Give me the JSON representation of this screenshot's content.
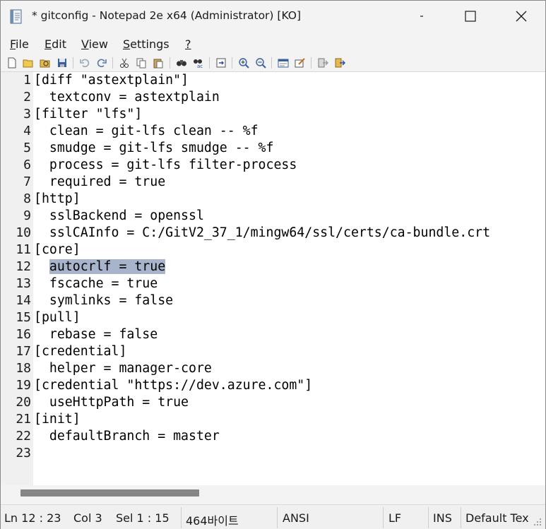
{
  "window": {
    "title": "* gitconfig - Notepad 2e x64 (Administrator) [KO]",
    "min_icon": "minimize-icon",
    "max_icon": "maximize-icon",
    "close_icon": "close-icon"
  },
  "menu": [
    {
      "label": "File",
      "u": "F",
      "rest": "ile"
    },
    {
      "label": "Edit",
      "u": "E",
      "rest": "dit"
    },
    {
      "label": "View",
      "u": "V",
      "rest": "iew"
    },
    {
      "label": "Settings",
      "u": "S",
      "rest": "ettings"
    },
    {
      "label": "?",
      "u": "?",
      "rest": ""
    }
  ],
  "toolbar": [
    "new-file-icon",
    "open-file-icon",
    "browse-icon",
    "save-icon",
    "undo-icon",
    "redo-icon",
    "cut-icon",
    "copy-icon",
    "paste-icon",
    "find-icon",
    "replace-icon",
    "goto-icon",
    "zoom-in-icon",
    "zoom-out-icon",
    "word-wrap-icon",
    "scheme-icon",
    "exit-icon",
    "save-and-exit-icon"
  ],
  "editor": {
    "lines": [
      {
        "n": "1",
        "text": "[diff \"astextplain\"]"
      },
      {
        "n": "2",
        "text": "  textconv = astextplain"
      },
      {
        "n": "3",
        "text": "[filter \"lfs\"]"
      },
      {
        "n": "4",
        "text": "  clean = git-lfs clean -- %f"
      },
      {
        "n": "5",
        "text": "  smudge = git-lfs smudge -- %f"
      },
      {
        "n": "6",
        "text": "  process = git-lfs filter-process"
      },
      {
        "n": "7",
        "text": "  required = true"
      },
      {
        "n": "8",
        "text": "[http]"
      },
      {
        "n": "9",
        "text": "  sslBackend = openssl"
      },
      {
        "n": "10",
        "text": "  sslCAInfo = C:/GitV2_37_1/mingw64/ssl/certs/ca-bundle.crt"
      },
      {
        "n": "11",
        "text": "[core]"
      },
      {
        "n": "12",
        "indent": "  ",
        "selected": "autocrlf = true"
      },
      {
        "n": "13",
        "text": "  fscache = true"
      },
      {
        "n": "14",
        "text": "  symlinks = false"
      },
      {
        "n": "15",
        "text": "[pull]"
      },
      {
        "n": "16",
        "text": "  rebase = false"
      },
      {
        "n": "17",
        "text": "[credential]"
      },
      {
        "n": "18",
        "text": "  helper = manager-core"
      },
      {
        "n": "19",
        "text": "[credential \"https://dev.azure.com\"]"
      },
      {
        "n": "20",
        "text": "  useHttpPath = true"
      },
      {
        "n": "21",
        "text": "[init]"
      },
      {
        "n": "22",
        "text": "  defaultBranch = master"
      },
      {
        "n": "23",
        "text": ""
      }
    ]
  },
  "status": {
    "pos": "Ln 12 : 23",
    "col": "Col 3",
    "sel": "Sel 1 : 15",
    "size": "464바이트",
    "encoding": "ANSI",
    "eol": "LF",
    "ovr": "INS",
    "scheme": "Default Tex"
  },
  "colors": {
    "selection": "#a7b4cc",
    "scroll_thumb": "#858585"
  }
}
